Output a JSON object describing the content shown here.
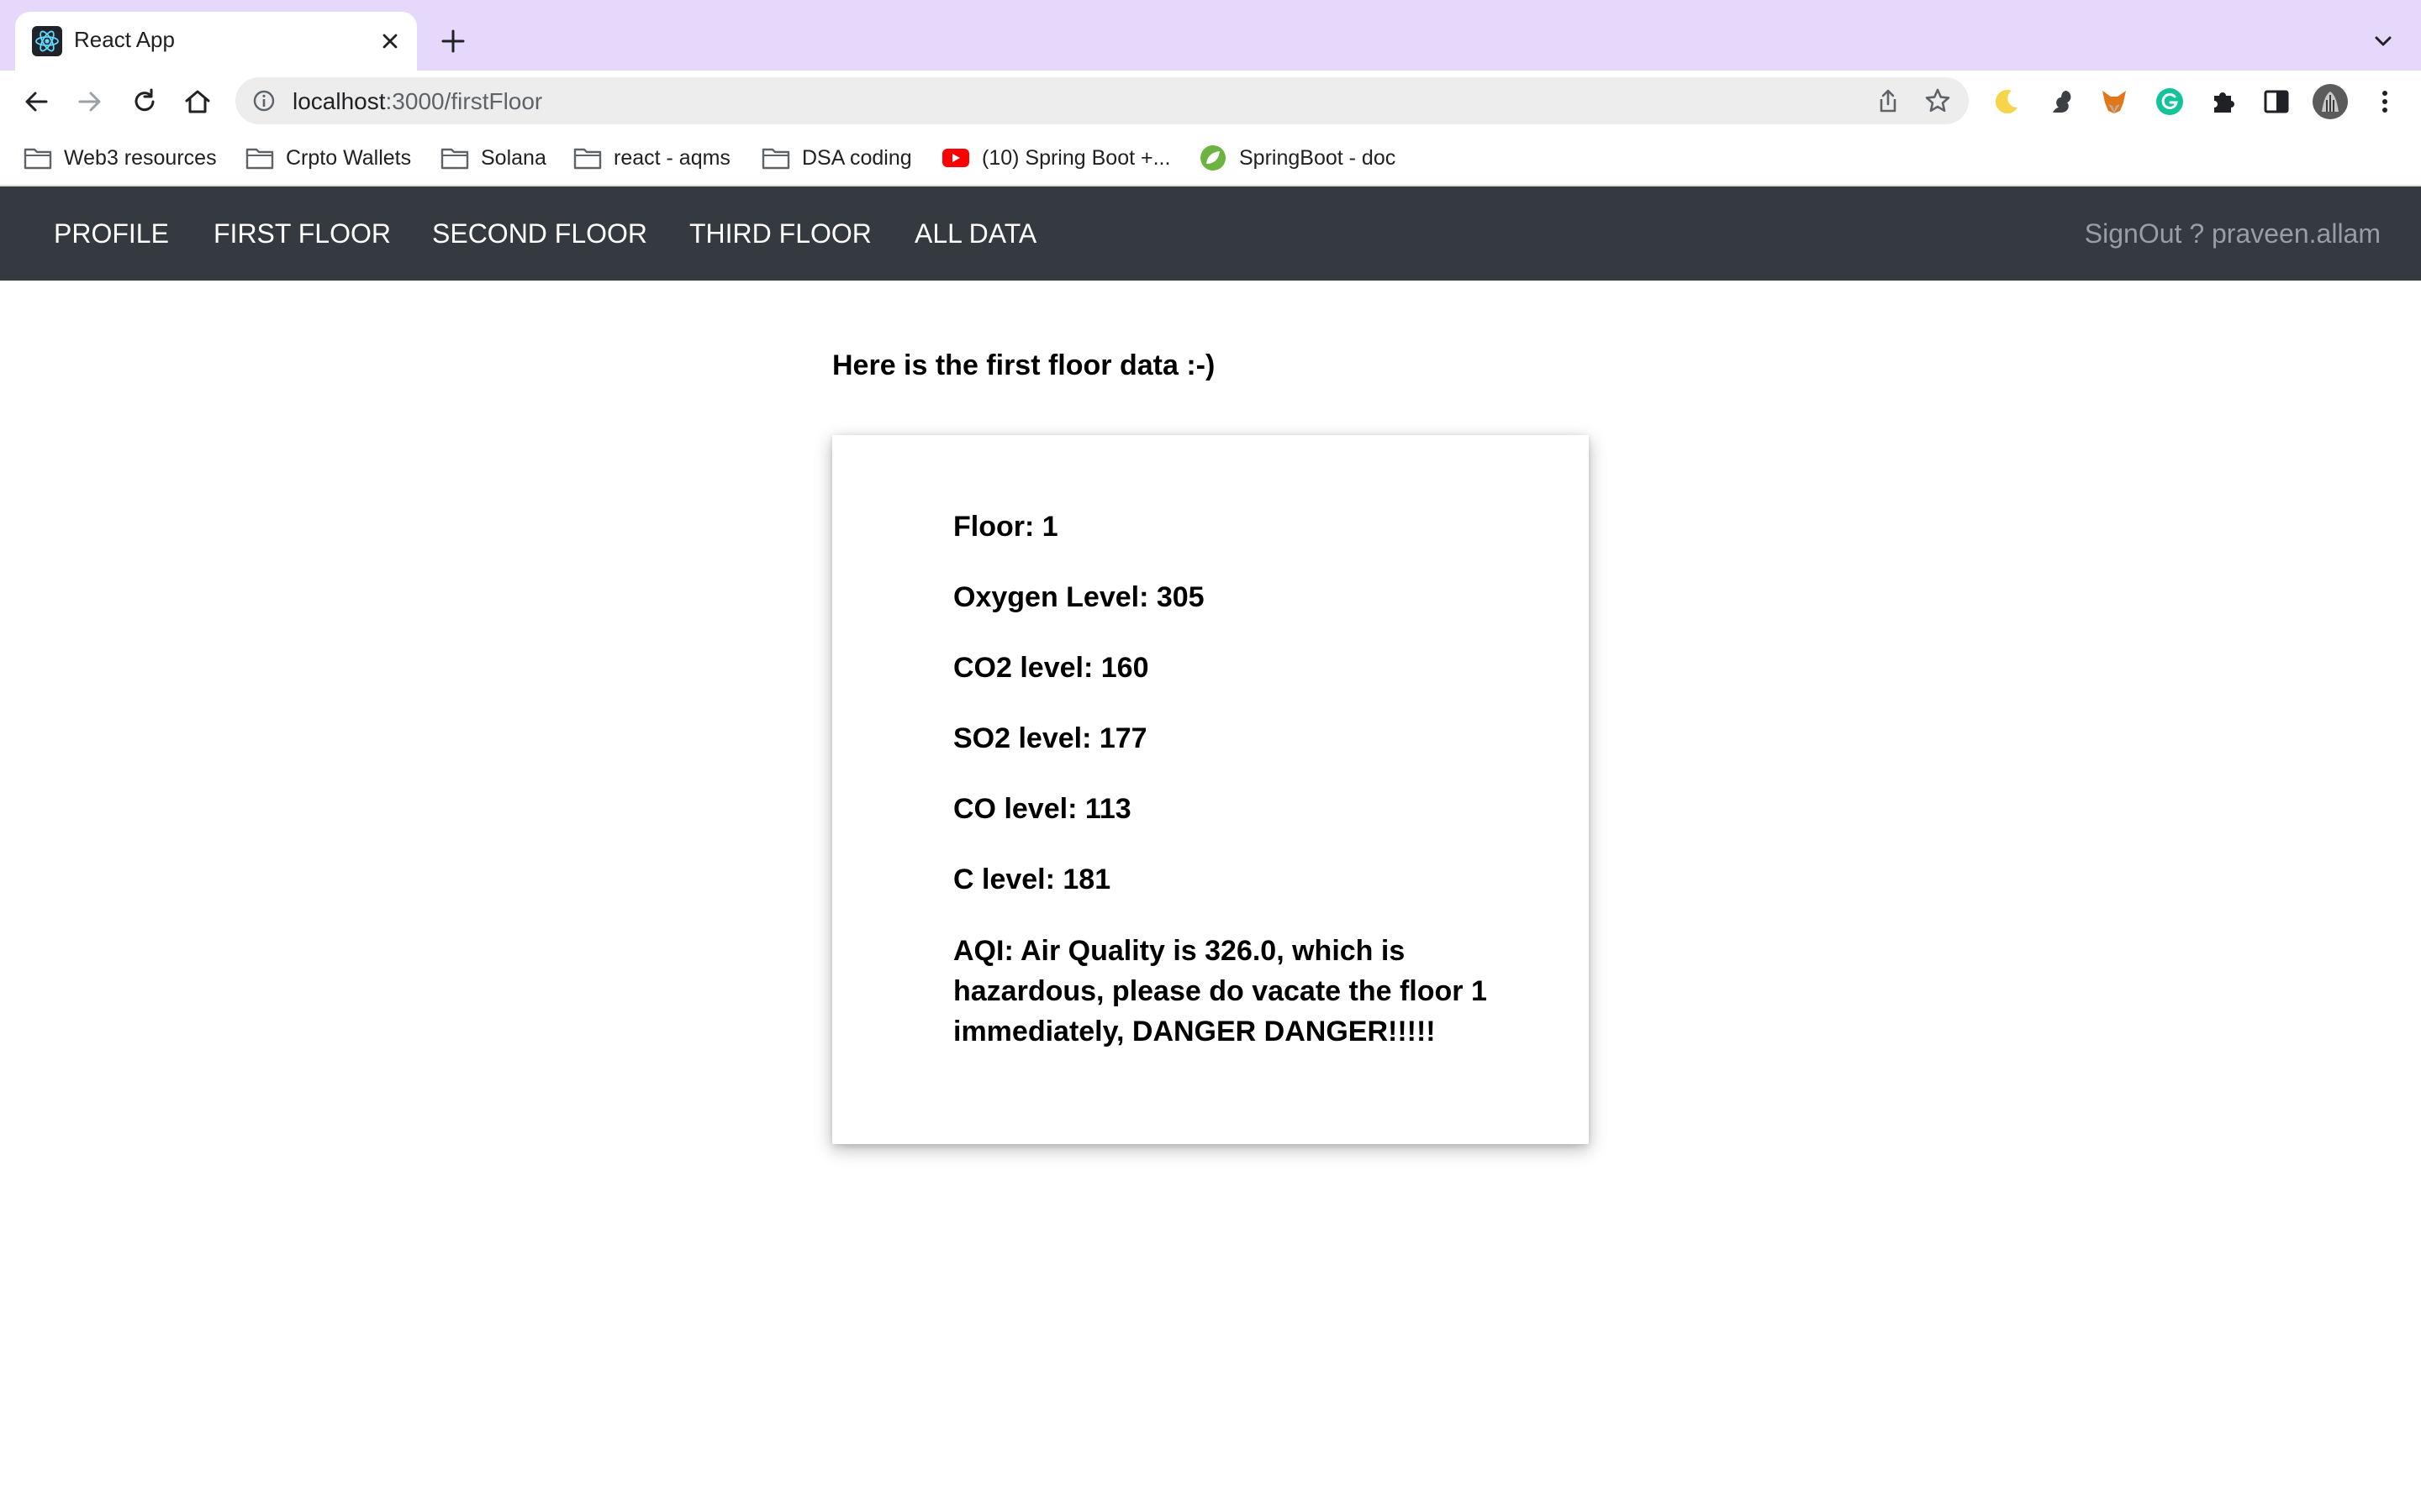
{
  "browser": {
    "tab_title": "React App",
    "url_host": "localhost",
    "url_path": ":3000/firstFloor",
    "icons": {
      "tab": "react-icon",
      "close": "close-icon",
      "new_tab": "plus-icon",
      "tab_search": "chevron-down-icon",
      "back": "back-arrow-icon",
      "forward": "forward-arrow-icon",
      "reload": "reload-icon",
      "home": "home-icon",
      "site_info": "info-icon",
      "share": "share-icon",
      "bookmark_star": "star-icon",
      "extensions": [
        "moon-icon",
        "squirrel-icon",
        "fox-icon",
        "grammarly-icon",
        "puzzle-icon",
        "side-panel-icon",
        "avatar"
      ]
    },
    "bookmarks": [
      {
        "label": "Web3 resources",
        "icon": "folder-icon"
      },
      {
        "label": "Crpto Wallets",
        "icon": "folder-icon"
      },
      {
        "label": "Solana",
        "icon": "folder-icon"
      },
      {
        "label": "react - aqms",
        "icon": "folder-icon"
      },
      {
        "label": "DSA coding",
        "icon": "folder-icon"
      },
      {
        "label": "(10) Spring Boot +...",
        "icon": "youtube-icon"
      },
      {
        "label": "SpringBoot - doc",
        "icon": "spring-icon"
      }
    ],
    "colors": {
      "tabstrip": "#e5d8fb",
      "omnibox": "#ededed"
    }
  },
  "app": {
    "nav": {
      "links": [
        "PROFILE",
        "FIRST FLOOR",
        "SECOND FLOOR",
        "THIRD FLOOR",
        "ALL DATA"
      ],
      "signout": "SignOut ? praveen.allam"
    },
    "heading": "Here is the first floor data :-)",
    "card": {
      "floor": "Floor: 1",
      "oxygen": "Oxygen Level: 305",
      "co2": "CO2 level: 160",
      "so2": "SO2 level: 177",
      "co": "CO level: 113",
      "c": "C level: 181",
      "aqi": "AQI: Air Quality is 326.0, which is hazardous, please do vacate the floor 1 immediately, DANGER DANGER!!!!!"
    },
    "colors": {
      "navbar": "#343a40",
      "nav_link": "#ffffff",
      "signout": "#9a9da1"
    }
  }
}
